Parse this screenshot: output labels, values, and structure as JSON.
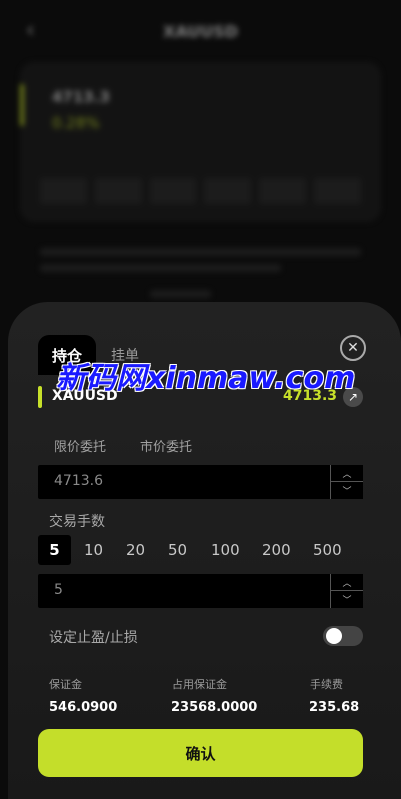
{
  "background": {
    "title": "XAUUSD",
    "price": "4713.3",
    "change": "0.28%"
  },
  "tabs": [
    {
      "label": "持仓",
      "active": true
    },
    {
      "label": "挂单",
      "active": false
    }
  ],
  "symbol": {
    "name": "XAUUSD",
    "price": "4713.3"
  },
  "order_types": [
    "限价委托",
    "市价委托"
  ],
  "price_input": {
    "value": "4713.6"
  },
  "lots": {
    "label": "交易手数",
    "options": [
      "5",
      "10",
      "20",
      "50",
      "100",
      "200",
      "500"
    ],
    "selected": "5",
    "input_value": "5"
  },
  "stop": {
    "label": "设定止盈/止损",
    "enabled": false
  },
  "stats": {
    "margin_label": "保证金",
    "margin_value": "546.0900",
    "used_margin_label": "占用保证金",
    "used_margin_value": "23568.0000",
    "fee_label": "手续费",
    "fee_value": "235.68"
  },
  "confirm_label": "确认",
  "watermark": "新码网xinmaw.com",
  "colors": {
    "accent": "#c4de2a",
    "sheet": "#1f1f1f",
    "background": "#0b0b0b"
  }
}
